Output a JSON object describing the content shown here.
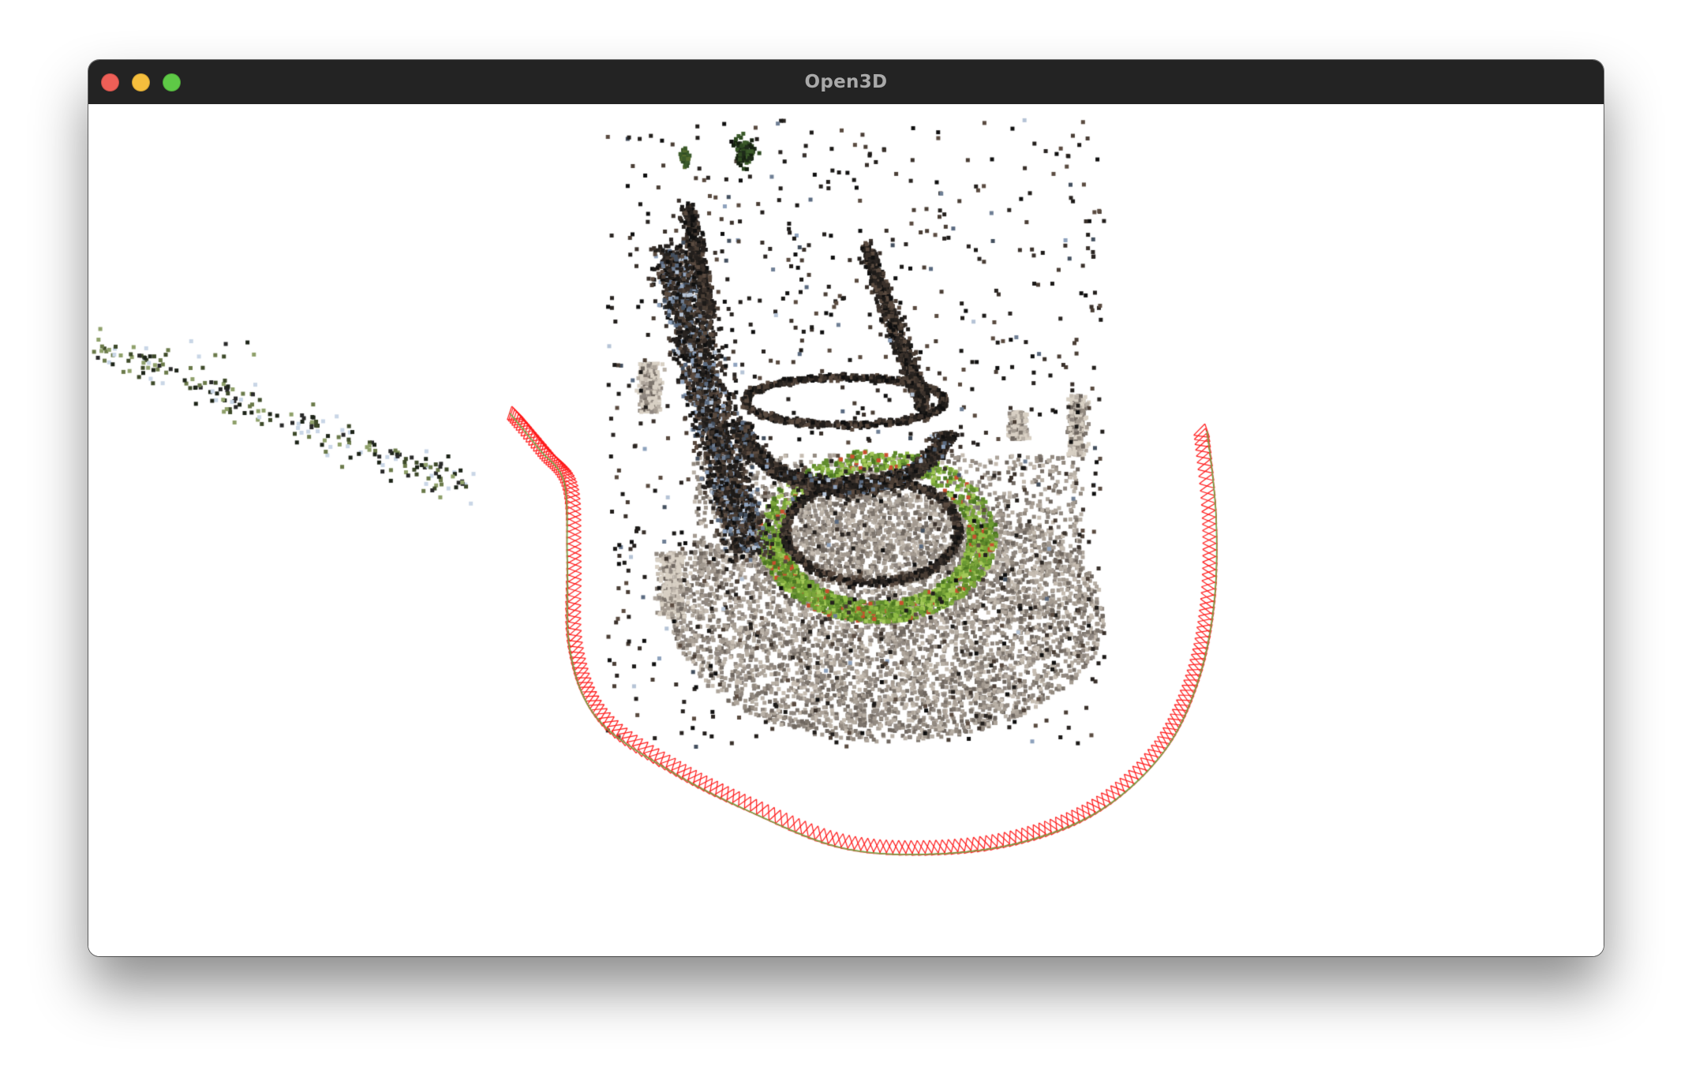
{
  "window": {
    "title": "Open3D",
    "buttons": [
      {
        "name": "close",
        "color": "#ee5f57"
      },
      {
        "name": "minimize",
        "color": "#f5be3d"
      },
      {
        "name": "zoom",
        "color": "#5ec946"
      }
    ]
  },
  "viewport": {
    "background": "#ffffff",
    "camera_trajectory_color": "#ff1a1a",
    "trajectory_accent_color": "#6ab04c"
  }
}
